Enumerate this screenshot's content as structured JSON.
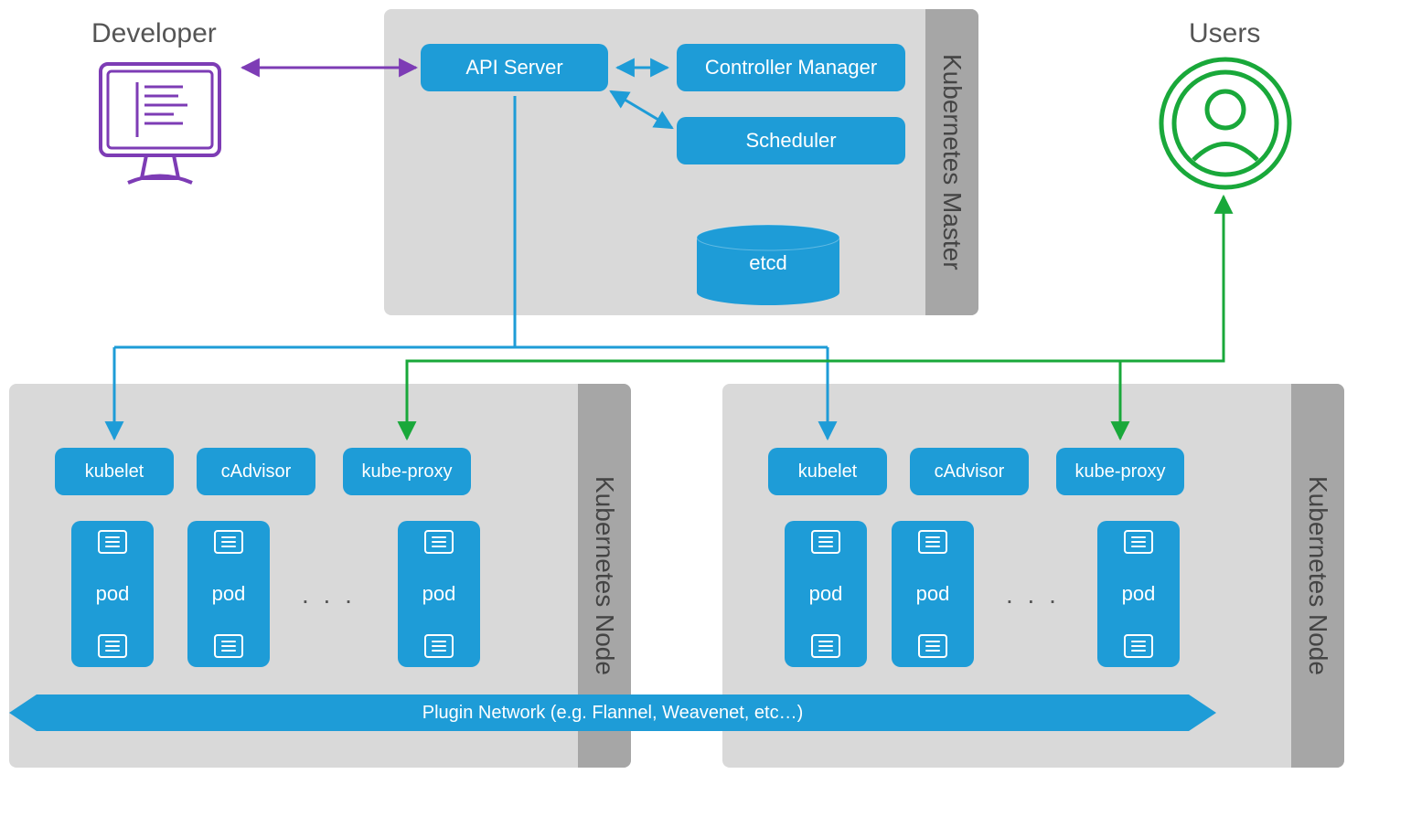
{
  "developer": {
    "label": "Developer"
  },
  "users": {
    "label": "Users"
  },
  "master": {
    "title": "Kubernetes Master",
    "api_server": "API Server",
    "controller_manager": "Controller Manager",
    "scheduler": "Scheduler",
    "etcd": "etcd"
  },
  "node": {
    "title": "Kubernetes Node",
    "kubelet": "kubelet",
    "cadvisor": "cAdvisor",
    "kube_proxy": "kube-proxy",
    "pod": "pod",
    "ellipsis": ". . ."
  },
  "network": {
    "label": "Plugin Network (e.g. Flannel, Weavenet, etc…)"
  },
  "colors": {
    "blue": "#1e9cd7",
    "purple": "#7d3cb5",
    "green": "#19a83a",
    "panel_bg": "#d9d9d9",
    "panel_tab": "#a6a6a6"
  }
}
